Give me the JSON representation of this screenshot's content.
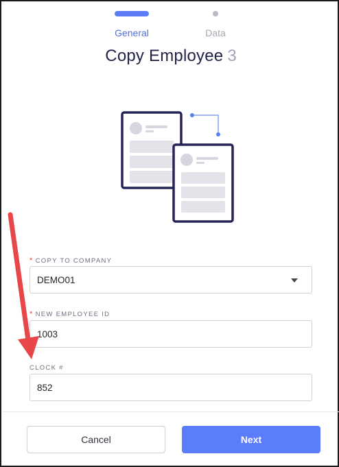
{
  "stepper": {
    "steps": [
      {
        "label": "General",
        "active": true
      },
      {
        "label": "Data",
        "active": false
      }
    ]
  },
  "header": {
    "title": "Copy Employee",
    "count": "3"
  },
  "form": {
    "company": {
      "label": "COPY TO COMPANY",
      "required": "*",
      "value": "DEMO01"
    },
    "employee_id": {
      "label": "NEW EMPLOYEE ID",
      "required": "*",
      "value": "1003"
    },
    "clock": {
      "label": "CLOCK #",
      "value": "852"
    }
  },
  "footer": {
    "cancel_label": "Cancel",
    "next_label": "Next"
  },
  "colors": {
    "accent": "#5b7cfb",
    "title": "#23234a",
    "required": "#e04545",
    "annotation_arrow": "#e8474a"
  }
}
